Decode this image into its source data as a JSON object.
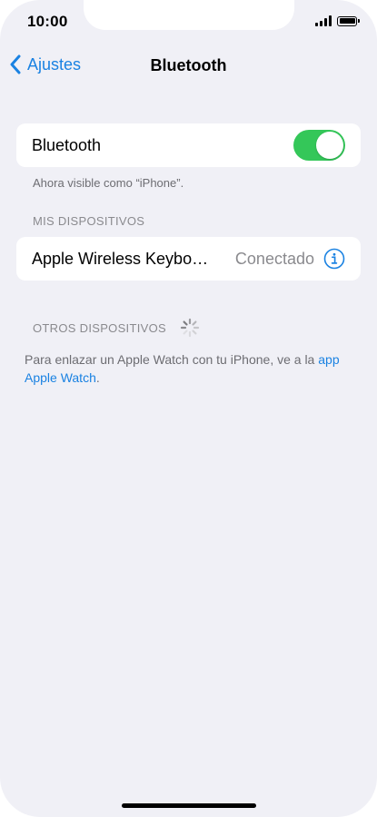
{
  "status_bar": {
    "time": "10:00"
  },
  "nav": {
    "back_label": "Ajustes",
    "title": "Bluetooth"
  },
  "bluetooth_row": {
    "label": "Bluetooth",
    "toggle_on": true
  },
  "visibility_caption": "Ahora visible como “iPhone”.",
  "my_devices": {
    "header": "MIS DISPOSITIVOS",
    "items": [
      {
        "name": "Apple Wireless Keybo…",
        "status": "Conectado"
      }
    ]
  },
  "other_devices": {
    "header": "OTROS DISPOSITIVOS"
  },
  "watch_note": {
    "text": "Para enlazar un Apple Watch con tu iPhone, ve a la ",
    "link": "app Apple Watch",
    "end": "."
  },
  "colors": {
    "accent": "#1a82e2",
    "toggle_on": "#34c759",
    "background": "#f0f0f6"
  }
}
